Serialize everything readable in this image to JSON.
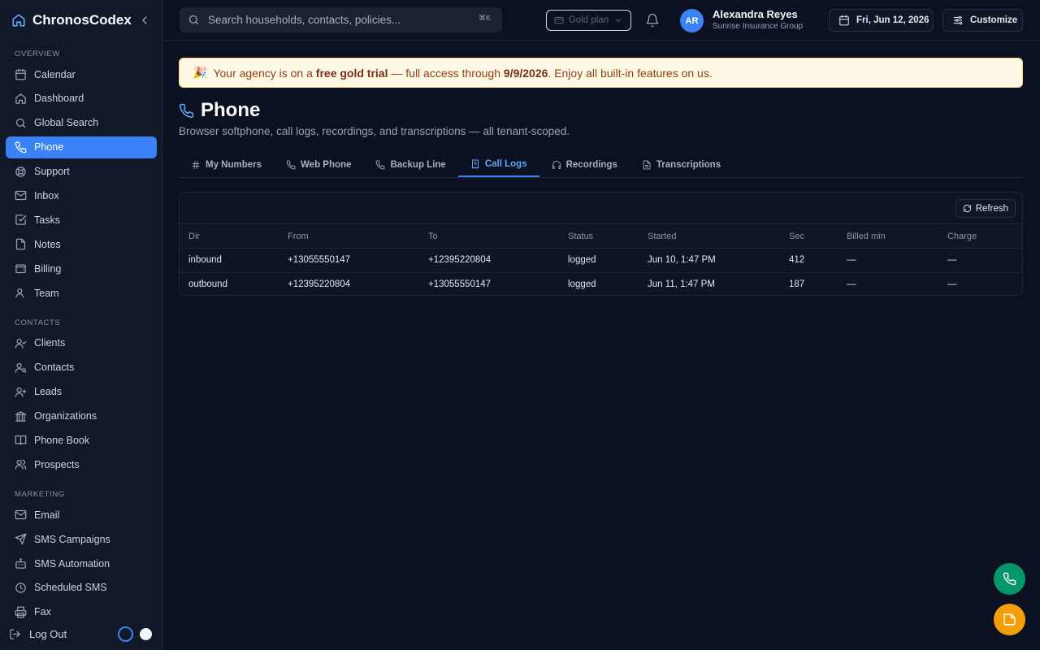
{
  "app": {
    "name": "ChronosCodex"
  },
  "sidebar": {
    "sections": [
      {
        "title": "OVERVIEW",
        "items": [
          {
            "label": "Calendar",
            "icon": "calendar-icon"
          },
          {
            "label": "Dashboard",
            "icon": "home-icon"
          },
          {
            "label": "Global Search",
            "icon": "search-icon"
          },
          {
            "label": "Phone",
            "icon": "phone-icon",
            "active": true
          },
          {
            "label": "Support",
            "icon": "lifebuoy-icon"
          },
          {
            "label": "Inbox",
            "icon": "mail-icon"
          },
          {
            "label": "Tasks",
            "icon": "check-square-icon"
          },
          {
            "label": "Notes",
            "icon": "file-icon"
          },
          {
            "label": "Billing",
            "icon": "wallet-icon"
          },
          {
            "label": "Team",
            "icon": "user-icon"
          }
        ]
      },
      {
        "title": "CONTACTS",
        "items": [
          {
            "label": "Clients",
            "icon": "user-check-icon"
          },
          {
            "label": "Contacts",
            "icon": "user-search-icon"
          },
          {
            "label": "Leads",
            "icon": "user-plus-icon"
          },
          {
            "label": "Organizations",
            "icon": "building-icon"
          },
          {
            "label": "Phone Book",
            "icon": "book-icon"
          },
          {
            "label": "Prospects",
            "icon": "users-icon"
          }
        ]
      },
      {
        "title": "MARKETING",
        "items": [
          {
            "label": "Email",
            "icon": "mail-icon"
          },
          {
            "label": "SMS Campaigns",
            "icon": "send-icon"
          },
          {
            "label": "SMS Automation",
            "icon": "bot-icon"
          },
          {
            "label": "Scheduled SMS",
            "icon": "clock-icon"
          },
          {
            "label": "Fax",
            "icon": "printer-icon"
          }
        ]
      }
    ],
    "logout_label": "Log Out"
  },
  "header": {
    "search_placeholder": "Search households, contacts, policies...",
    "search_shortcut": "⌘K",
    "plan_label": "Gold plan",
    "user": {
      "initials": "AR",
      "name": "Alexandra Reyes",
      "org": "Sunrise Insurance Group"
    },
    "date_label": "Fri, Jun 12, 2026",
    "customize_label": "Customize"
  },
  "banner": {
    "emoji": "🎉",
    "pre": "Your agency is on a ",
    "highlight": "free gold trial",
    "mid": " — full access through ",
    "date": "9/9/2026",
    "post": ". Enjoy all built-in features on us."
  },
  "page": {
    "title": "Phone",
    "subtitle": "Browser softphone, call logs, recordings, and transcriptions — all tenant-scoped.",
    "tabs": [
      {
        "label": "My Numbers",
        "icon": "hash-icon"
      },
      {
        "label": "Web Phone",
        "icon": "phone-icon"
      },
      {
        "label": "Backup Line",
        "icon": "phone-icon"
      },
      {
        "label": "Call Logs",
        "icon": "list-icon",
        "active": true
      },
      {
        "label": "Recordings",
        "icon": "headphones-icon"
      },
      {
        "label": "Transcriptions",
        "icon": "file-text-icon"
      }
    ]
  },
  "call_logs": {
    "refresh_label": "Refresh",
    "columns": [
      "Dir",
      "From",
      "To",
      "Status",
      "Started",
      "Sec",
      "Billed min",
      "Charge"
    ],
    "rows": [
      [
        "inbound",
        "+13055550147",
        "+12395220804",
        "logged",
        "Jun 10, 1:47 PM",
        "412",
        "—",
        "—"
      ],
      [
        "outbound",
        "+12395220804",
        "+13055550147",
        "logged",
        "Jun 11, 1:47 PM",
        "187",
        "—",
        "—"
      ]
    ]
  },
  "colors": {
    "accent": "#3b82f6",
    "background": "#0b1120",
    "sidebar": "#111827",
    "banner_bg": "#fef9e7",
    "fab_phone": "#059669",
    "fab_note": "#f59e0b"
  }
}
